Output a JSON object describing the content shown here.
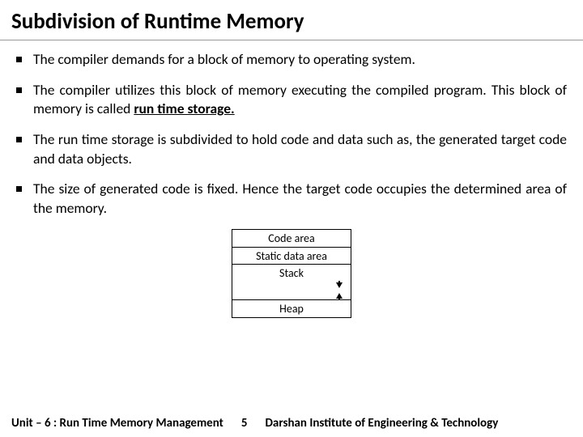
{
  "title": "Subdivision of Runtime Memory",
  "bullets": [
    {
      "text": "The compiler demands for a block of memory to operating system."
    },
    {
      "text_before": "The compiler utilizes this block of memory executing the compiled program. This block of memory is called ",
      "bold": "run time storage.",
      "text_after": ""
    },
    {
      "text": "The run time storage is subdivided to hold code and data such as, the generated target code and data objects."
    },
    {
      "text": "The size of generated code is fixed. Hence the target code occupies the determined area of the memory."
    }
  ],
  "diagram": {
    "rows": [
      "Code area",
      "Static data area",
      "Stack",
      "Heap"
    ]
  },
  "footer": {
    "left": "Unit – 6 : Run Time Memory Management",
    "page": "5",
    "right": "Darshan Institute of Engineering & Technology"
  }
}
